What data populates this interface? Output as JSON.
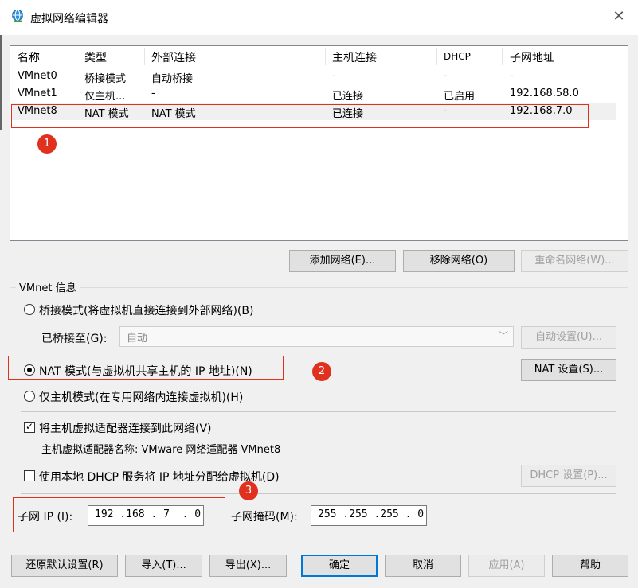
{
  "window": {
    "title": "虚拟网络编辑器",
    "close_glyph": "✕"
  },
  "table": {
    "headers": [
      "名称",
      "类型",
      "外部连接",
      "主机连接",
      "DHCP",
      "子网地址"
    ],
    "rows": [
      [
        "VMnet0",
        "桥接模式",
        "自动桥接",
        "-",
        "-",
        "-"
      ],
      [
        "VMnet1",
        "仅主机...",
        "-",
        "已连接",
        "已启用",
        "192.168.58.0"
      ],
      [
        "VMnet8",
        "NAT 模式",
        "NAT 模式",
        "已连接",
        "-",
        "192.168.7.0"
      ]
    ]
  },
  "list_buttons": {
    "add": "添加网络(E)...",
    "remove": "移除网络(O)",
    "rename": "重命名网络(W)..."
  },
  "info": {
    "group_label": "VMnet 信息",
    "bridge_mode": "桥接模式(将虚拟机直接连接到外部网络)(B)",
    "bridged_to_label": "已桥接至(G):",
    "bridged_to_value": "自动",
    "auto_settings": "自动设置(U)...",
    "nat_mode": "NAT 模式(与虚拟机共享主机的 IP 地址)(N)",
    "nat_settings": "NAT 设置(S)...",
    "host_only_mode": "仅主机模式(在专用网络内连接虚拟机)(H)",
    "connect_adapter": "将主机虚拟适配器连接到此网络(V)",
    "adapter_name": "主机虚拟适配器名称: VMware 网络适配器 VMnet8",
    "use_dhcp": "使用本地 DHCP 服务将 IP 地址分配给虚拟机(D)",
    "dhcp_settings": "DHCP 设置(P)...",
    "subnet_ip_label": "子网 IP (I):",
    "subnet_ip_value": "192 .168 . 7  . 0",
    "subnet_mask_label": "子网掩码(M):",
    "subnet_mask_value": "255 .255 .255 . 0"
  },
  "bottom_buttons": {
    "restore": "还原默认设置(R)",
    "import": "导入(T)...",
    "export": "导出(X)...",
    "ok": "确定",
    "cancel": "取消",
    "apply": "应用(A)",
    "help": "帮助"
  },
  "annotations": {
    "b1": "1",
    "b2": "2",
    "b3": "3"
  },
  "colors": {
    "callout": "#e0301e",
    "focus": "#0078d7"
  }
}
